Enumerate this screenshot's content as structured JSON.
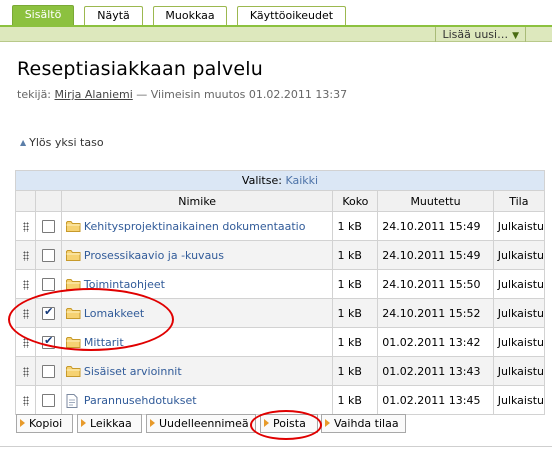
{
  "tabs": [
    {
      "label": "Sisältö",
      "active": true
    },
    {
      "label": "Näytä",
      "active": false
    },
    {
      "label": "Muokkaa",
      "active": false
    },
    {
      "label": "Käyttöoikeudet",
      "active": false
    }
  ],
  "toolbar": {
    "add_new_label": "Lisää uusi…",
    "add_new_caret": "▼"
  },
  "page": {
    "title": "Reseptiasiakkaan palvelu",
    "byline_prefix": "tekijä:",
    "author": "Mirja Alaniemi",
    "byline_suffix": "— Viimeisin muutos 01.02.2011 13:37",
    "up_link": "Ylös yksi taso"
  },
  "table": {
    "select_label": "Valitse:",
    "select_all": "Kaikki",
    "columns": {
      "name": "Nimike",
      "size": "Koko",
      "modified": "Muutettu",
      "state": "Tila"
    },
    "rows": [
      {
        "name": "Kehitysprojektinaikainen dokumentaatio",
        "size": "1 kB",
        "modified": "24.10.2011 15:49",
        "state": "Julkaistu",
        "checked": false,
        "icon": "folder-icon"
      },
      {
        "name": "Prosessikaavio ja -kuvaus",
        "size": "1 kB",
        "modified": "24.10.2011 15:49",
        "state": "Julkaistu",
        "checked": false,
        "icon": "folder-icon"
      },
      {
        "name": "Toimintaohjeet",
        "size": "1 kB",
        "modified": "24.10.2011 15:50",
        "state": "Julkaistu",
        "checked": false,
        "icon": "folder-icon"
      },
      {
        "name": "Lomakkeet",
        "size": "1 kB",
        "modified": "24.10.2011 15:52",
        "state": "Julkaistu",
        "checked": true,
        "icon": "folder-icon"
      },
      {
        "name": "Mittarit",
        "size": "1 kB",
        "modified": "01.02.2011 13:42",
        "state": "Julkaistu",
        "checked": true,
        "icon": "folder-icon"
      },
      {
        "name": "Sisäiset arvioinnit",
        "size": "1 kB",
        "modified": "01.02.2011 13:43",
        "state": "Julkaistu",
        "checked": false,
        "icon": "folder-icon"
      },
      {
        "name": "Parannusehdotukset",
        "size": "1 kB",
        "modified": "01.02.2011 13:45",
        "state": "Julkaistu",
        "checked": false,
        "icon": "document-icon"
      }
    ]
  },
  "actions": {
    "copy": "Kopioi",
    "cut": "Leikkaa",
    "rename": "Uudelleennimeä",
    "delete": "Poista",
    "change_state": "Vaihda tilaa"
  },
  "colors": {
    "accent_green": "#8cc13f",
    "link_blue": "#315b99",
    "annotation_red": "#e00000",
    "button_bullet": "#e79a2a"
  }
}
